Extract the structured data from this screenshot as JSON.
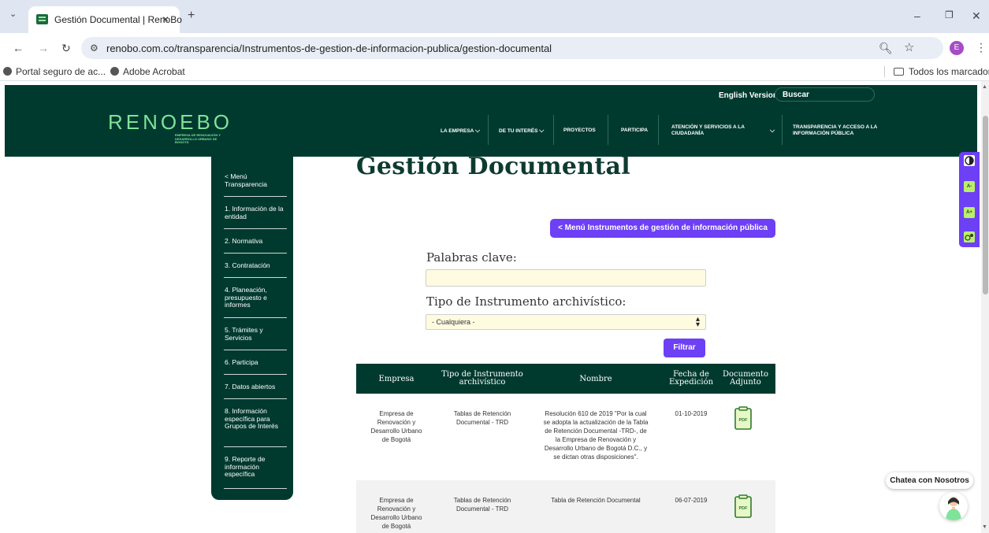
{
  "browser": {
    "tab_title": "Gestión Documental | RenoBo",
    "tab_close": "×",
    "new_tab": "+",
    "url": "renobo.com.co/transparencia/Instrumentos-de-gestion-de-informacion-publica/gestion-documental",
    "profile_initial": "E",
    "window_controls": [
      "–",
      "❐",
      "✕"
    ],
    "bookmarks": [
      "Portal seguro de ac...",
      "Adobe Acrobat"
    ],
    "all_bookmarks": "Todos los marcadores"
  },
  "header": {
    "logo": "RENOEBO",
    "logo_sub": "EMPRESA DE RENOVACIÓN Y DESARROLLO URBANO DE BOGOTÁ",
    "english_version": "English Version",
    "search_placeholder": "Buscar",
    "nav": [
      {
        "label": "LA EMPRESA"
      },
      {
        "label": "DE TU INTERÉS"
      },
      {
        "label": "PROYECTOS"
      },
      {
        "label": "PARTICIPA"
      },
      {
        "label": "ATENCIÓN Y SERVICIOS A LA CIUDADANÍA"
      },
      {
        "label": "TRANSPARENCIA Y ACCESO A LA INFORMACIÓN PÚBLICA"
      }
    ]
  },
  "sidebar": {
    "items": [
      "< Menú Transparencia",
      "1. Información de la entidad",
      "2. Normativa",
      "3. Contratación",
      "4. Planeación, presupuesto e informes",
      "5. Trámites y Servicios",
      "6. Participa",
      "7. Datos abiertos",
      "8. Información específica para Grupos de Interés",
      "9. Reporte de información específica"
    ]
  },
  "main": {
    "title": "Gestión Documental",
    "menu_button": "< Menú Instrumentos de gestión de información pública",
    "keyword_label": "Palabras clave:",
    "keyword_value": "",
    "type_label": "Tipo de Instrumento archivístico:",
    "type_selected": "- Cualquiera -",
    "filter_button": "Filtrar",
    "table": {
      "headers": [
        "Empresa",
        "Tipo de Instrumento archivístico",
        "Nombre",
        "Fecha de Expedición",
        "Documento Adjunto"
      ],
      "rows": [
        {
          "empresa": "Empresa de Renovación y Desarrollo Urbano de Bogotá",
          "tipo": "Tablas de Retención Documental - TRD",
          "nombre": "Resolución 610 de 2019 \"Por la cual se adopta la actualización de la Tabla de Retención Documental -TRD-, de la Empresa de Renovación y Desarrollo Urbano de Bogotá D.C., y se dictan otras disposiciones\".",
          "fecha": "01-10-2019",
          "doc": "PDF"
        },
        {
          "empresa": "Empresa de Renovación y Desarrollo Urbano de Bogotá",
          "tipo": "Tablas de Retención Documental - TRD",
          "nombre": "Tabla de Retención Documental",
          "fecha": "06-07-2019",
          "doc": "PDF"
        }
      ]
    }
  },
  "accessibility": {
    "buttons": [
      "contrast",
      "A-",
      "A+",
      "accessibility"
    ]
  },
  "chat": {
    "label": "Chatea con Nosotros"
  },
  "colors": {
    "brand_dark": "#003a2f",
    "brand_green": "#7fe39a",
    "accent_purple": "#6d3ff5",
    "input_bg": "#fffbe1"
  }
}
